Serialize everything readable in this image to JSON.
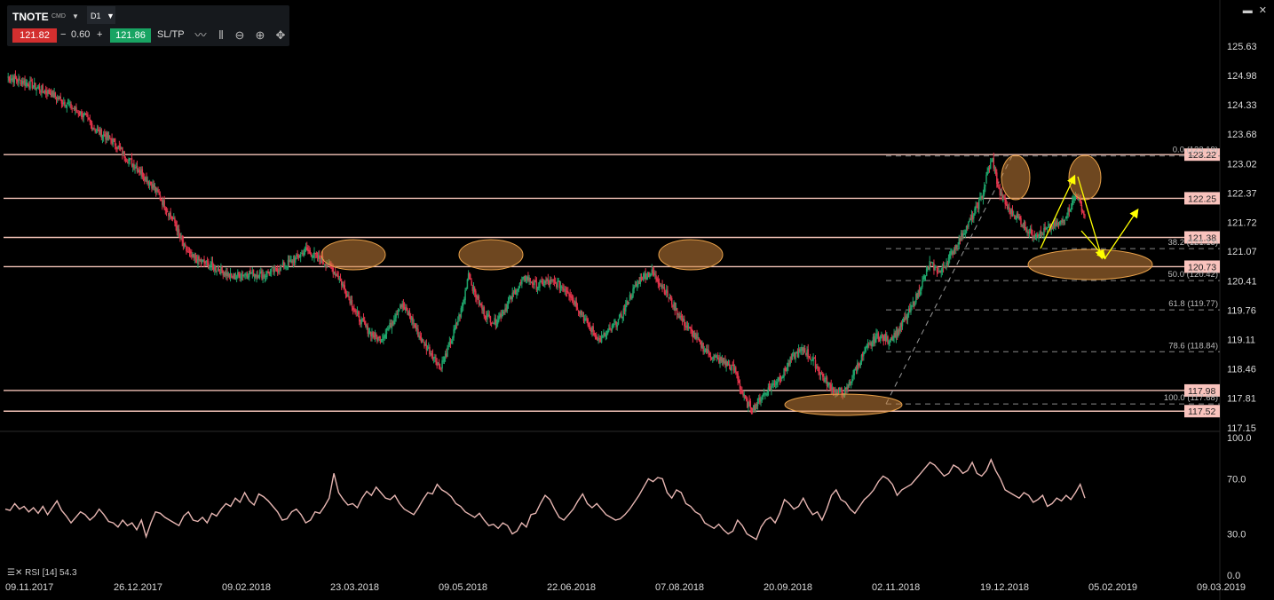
{
  "toolbar": {
    "symbol": "TNOTE",
    "symbol_type": "CMD",
    "timeframe": "D1",
    "bid": "121.82",
    "change": "0.60",
    "ask": "121.86",
    "sltp": "SL/TP",
    "minus": "−",
    "plus": "+",
    "icons": [
      "line-chart-icon",
      "candles-icon",
      "zoom-out-icon",
      "zoom-in-icon",
      "crosshair-icon"
    ]
  },
  "window_controls": {
    "minimize": "▬",
    "close": "✕"
  },
  "rsi_label": "RSI [14] 54.3",
  "colors": {
    "bull": "#1ea36a",
    "bear": "#e0334a",
    "level": "#f4c4b8",
    "tag_bg": "#f9c3bd",
    "ellipse": "#c8823a",
    "arrow": "#ffff00",
    "rsi": "#e7b6b2"
  },
  "chart_data": [
    {
      "type": "candlestick",
      "x_ticks": [
        "09.11.2017",
        "26.12.2017",
        "09.02.2018",
        "23.03.2018",
        "09.05.2018",
        "22.06.2018",
        "07.08.2018",
        "20.09.2018",
        "02.11.2018",
        "19.12.2018",
        "05.02.2019",
        "09.03.2019"
      ],
      "y_ticks": [
        "125.63",
        "124.98",
        "124.33",
        "123.68",
        "123.02",
        "122.37",
        "121.72",
        "121.07",
        "120.41",
        "119.76",
        "119.11",
        "118.46",
        "117.81",
        "117.15"
      ],
      "ylim": [
        117.15,
        125.63
      ],
      "approx_close_path": [
        [
          0,
          124.95
        ],
        [
          20,
          124.8
        ],
        [
          40,
          124.6
        ],
        [
          60,
          124.3
        ],
        [
          75,
          124.05
        ],
        [
          85,
          123.75
        ],
        [
          100,
          123.55
        ],
        [
          112,
          123.2
        ],
        [
          125,
          122.9
        ],
        [
          140,
          122.5
        ],
        [
          150,
          122.1
        ],
        [
          160,
          121.7
        ],
        [
          168,
          121.2
        ],
        [
          175,
          120.95
        ],
        [
          185,
          120.85
        ],
        [
          200,
          120.7
        ],
        [
          215,
          120.5
        ],
        [
          230,
          120.6
        ],
        [
          245,
          120.55
        ],
        [
          260,
          120.7
        ],
        [
          275,
          120.9
        ],
        [
          285,
          121.1
        ],
        [
          295,
          120.95
        ],
        [
          305,
          120.8
        ],
        [
          315,
          120.55
        ],
        [
          325,
          120.1
        ],
        [
          335,
          119.6
        ],
        [
          345,
          119.3
        ],
        [
          355,
          119.1
        ],
        [
          365,
          119.4
        ],
        [
          375,
          119.9
        ],
        [
          385,
          119.6
        ],
        [
          395,
          119.1
        ],
        [
          405,
          118.8
        ],
        [
          413,
          118.5
        ],
        [
          420,
          118.85
        ],
        [
          428,
          119.4
        ],
        [
          435,
          119.9
        ],
        [
          440,
          120.6
        ],
        [
          445,
          120.2
        ],
        [
          455,
          119.7
        ],
        [
          465,
          119.5
        ],
        [
          475,
          119.8
        ],
        [
          485,
          120.2
        ],
        [
          495,
          120.5
        ],
        [
          505,
          120.3
        ],
        [
          515,
          120.4
        ],
        [
          525,
          120.35
        ],
        [
          535,
          120.2
        ],
        [
          545,
          119.8
        ],
        [
          555,
          119.4
        ],
        [
          565,
          119.1
        ],
        [
          575,
          119.3
        ],
        [
          585,
          119.6
        ],
        [
          595,
          120.1
        ],
        [
          605,
          120.5
        ],
        [
          615,
          120.6
        ],
        [
          625,
          120.3
        ],
        [
          635,
          119.9
        ],
        [
          645,
          119.5
        ],
        [
          655,
          119.2
        ],
        [
          665,
          118.9
        ],
        [
          675,
          118.7
        ],
        [
          685,
          118.6
        ],
        [
          695,
          118.4
        ],
        [
          700,
          118.0
        ],
        [
          705,
          117.7
        ],
        [
          712,
          117.6
        ],
        [
          720,
          117.85
        ],
        [
          730,
          118.1
        ],
        [
          740,
          118.35
        ],
        [
          750,
          118.75
        ],
        [
          760,
          118.9
        ],
        [
          770,
          118.6
        ],
        [
          780,
          118.2
        ],
        [
          790,
          117.95
        ],
        [
          800,
          117.95
        ],
        [
          810,
          118.5
        ],
        [
          820,
          118.9
        ],
        [
          830,
          119.2
        ],
        [
          840,
          119.1
        ],
        [
          850,
          119.3
        ],
        [
          860,
          119.7
        ],
        [
          870,
          120.2
        ],
        [
          880,
          120.8
        ],
        [
          890,
          120.6
        ],
        [
          900,
          121.0
        ],
        [
          910,
          121.4
        ],
        [
          920,
          121.8
        ],
        [
          930,
          122.3
        ],
        [
          936,
          122.9
        ],
        [
          940,
          123.1
        ],
        [
          946,
          122.4
        ],
        [
          955,
          122.0
        ],
        [
          965,
          121.8
        ],
        [
          975,
          121.5
        ],
        [
          985,
          121.45
        ],
        [
          995,
          121.6
        ],
        [
          1005,
          121.7
        ],
        [
          1015,
          122.1
        ],
        [
          1020,
          122.35
        ],
        [
          1028,
          121.85
        ]
      ],
      "horizontal_levels": [
        {
          "value": 123.22,
          "label": "123.22"
        },
        {
          "value": 122.25,
          "label": "122.25"
        },
        {
          "value": 121.38,
          "label": "121.38"
        },
        {
          "value": 120.73,
          "label": "120.73"
        },
        {
          "value": 117.98,
          "label": "117.98"
        },
        {
          "value": 117.52,
          "label": "117.52"
        }
      ],
      "fibonacci": [
        {
          "level": "0.0",
          "value": 123.19,
          "label": "0.0 (123.19)"
        },
        {
          "level": "38.2",
          "value": 121.13,
          "label": "38.2 (121.13)"
        },
        {
          "level": "50.0",
          "value": 120.42,
          "label": "50.0 (120.42)"
        },
        {
          "level": "61.8",
          "value": 119.77,
          "label": "61.8 (119.77)"
        },
        {
          "level": "78.6",
          "value": 118.84,
          "label": "78.6 (118.84)"
        },
        {
          "level": "100.0",
          "value": 117.68,
          "label": "100.0 (117.68)"
        }
      ]
    },
    {
      "type": "line",
      "name": "RSI [14]",
      "y_ticks": [
        "100.0",
        "70.0",
        "30.0",
        "0.0"
      ],
      "ylim": [
        0,
        100
      ],
      "values": [
        48,
        47,
        52,
        48,
        50,
        46,
        49,
        45,
        50,
        44,
        49,
        54,
        47,
        43,
        38,
        42,
        46,
        44,
        40,
        43,
        48,
        44,
        39,
        38,
        35,
        40,
        36,
        38,
        33,
        40,
        28,
        38,
        46,
        45,
        42,
        40,
        38,
        36,
        43,
        46,
        40,
        39,
        42,
        38,
        45,
        43,
        48,
        52,
        50,
        56,
        53,
        60,
        54,
        51,
        59,
        57,
        54,
        50,
        46,
        40,
        41,
        46,
        48,
        44,
        38,
        40,
        46,
        45,
        50,
        56,
        74,
        60,
        55,
        51,
        52,
        49,
        56,
        61,
        58,
        64,
        60,
        56,
        55,
        58,
        52,
        48,
        46,
        44,
        49,
        55,
        60,
        59,
        66,
        62,
        60,
        57,
        52,
        50,
        46,
        44,
        42,
        45,
        40,
        36,
        37,
        34,
        38,
        36,
        30,
        32,
        38,
        35,
        44,
        45,
        52,
        58,
        55,
        48,
        42,
        40,
        44,
        48,
        54,
        59,
        52,
        49,
        52,
        48,
        44,
        42,
        40,
        41,
        44,
        48,
        53,
        58,
        64,
        70,
        68,
        71,
        70,
        60,
        56,
        62,
        60,
        52,
        50,
        46,
        44,
        38,
        36,
        34,
        37,
        33,
        30,
        32,
        40,
        36,
        30,
        28,
        26,
        35,
        40,
        42,
        38,
        45,
        55,
        52,
        48,
        50,
        56,
        49,
        44,
        46,
        40,
        48,
        58,
        62,
        55,
        53,
        48,
        45,
        50,
        55,
        58,
        62,
        68,
        72,
        70,
        66,
        58,
        62,
        64,
        66,
        70,
        74,
        78,
        82,
        80,
        76,
        72,
        74,
        80,
        78,
        74,
        76,
        82,
        74,
        72,
        76,
        84,
        76,
        70,
        62,
        60,
        58,
        56,
        60,
        58,
        53,
        55,
        58,
        50,
        52,
        56,
        54,
        58,
        55,
        60,
        66,
        56
      ]
    }
  ]
}
